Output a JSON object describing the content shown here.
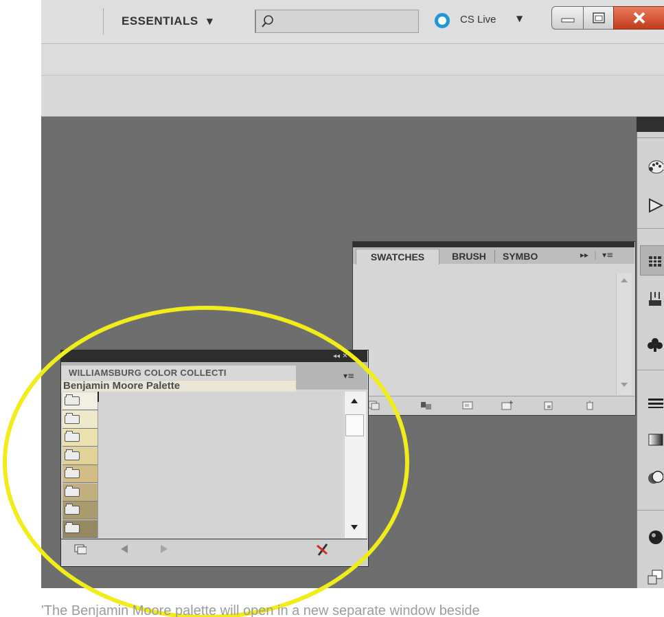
{
  "app_bar": {
    "workspace_label": "ESSENTIALS",
    "workspace_caret": "▼",
    "search_placeholder": "",
    "cs_live_label": "CS Live",
    "cs_live_caret": "▼"
  },
  "swatches_panel": {
    "tabs": [
      {
        "label": "SWATCHES",
        "active": true
      },
      {
        "label": "BRUSH",
        "active": false
      },
      {
        "label": "SYMBO",
        "active": false
      }
    ],
    "overflow_icon": "double-chevron-right-icon",
    "menu_icon": "panel-menu-icon",
    "footer_icons": [
      "swatch-libraries-icon",
      "show-swatch-kinds-icon",
      "swatch-options-icon",
      "new-color-group-icon",
      "new-swatch-icon",
      "delete-swatch-icon"
    ]
  },
  "library_panel": {
    "tab_title": "WILLIAMSBURG COLOR COLLECTI",
    "palette_label": "Benjamin Moore Palette",
    "swatch_rows": [
      {
        "color": "#f2efe2"
      },
      {
        "color": "#efe8c9"
      },
      {
        "color": "#ece0ae"
      },
      {
        "color": "#e3d19a"
      },
      {
        "color": "#d2bd86"
      },
      {
        "color": "#c2ae7e"
      },
      {
        "color": "#aa9a6e"
      },
      {
        "color": "#958860"
      }
    ],
    "footer_icons": [
      "library-menu-icon",
      "previous-library-icon",
      "next-library-icon",
      "add-to-swatches-icon"
    ]
  },
  "dock": {
    "icons": [
      "color-icon",
      "color-guide-icon",
      "swatches-icon",
      "brushes-icon",
      "symbols-icon",
      "stroke-icon",
      "gradient-icon",
      "transparency-icon",
      "appearance-icon",
      "graphic-styles-icon"
    ]
  },
  "annotation": {
    "color": "#f2ec1a"
  },
  "caption": "'The Benjamin Moore palette will open in a new separate window beside"
}
